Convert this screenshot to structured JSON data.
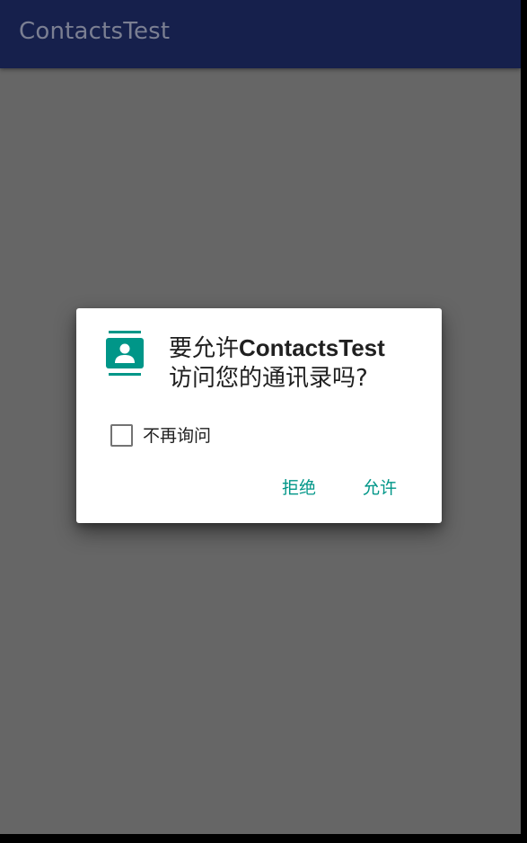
{
  "app_bar": {
    "title": "ContactsTest",
    "background": "#16204c"
  },
  "dialog": {
    "icon": "contacts-icon",
    "message_prefix": "要允许",
    "app_name": "ContactsTest",
    "message_suffix": "访问您的通讯录吗?",
    "checkbox": {
      "label": "不再询问",
      "checked": false
    },
    "buttons": {
      "deny_label": "拒绝",
      "allow_label": "允许"
    },
    "accent_color": "#009688"
  },
  "colors": {
    "scrim": "#666666",
    "dialog_background": "#ffffff",
    "text_primary": "#202020"
  }
}
